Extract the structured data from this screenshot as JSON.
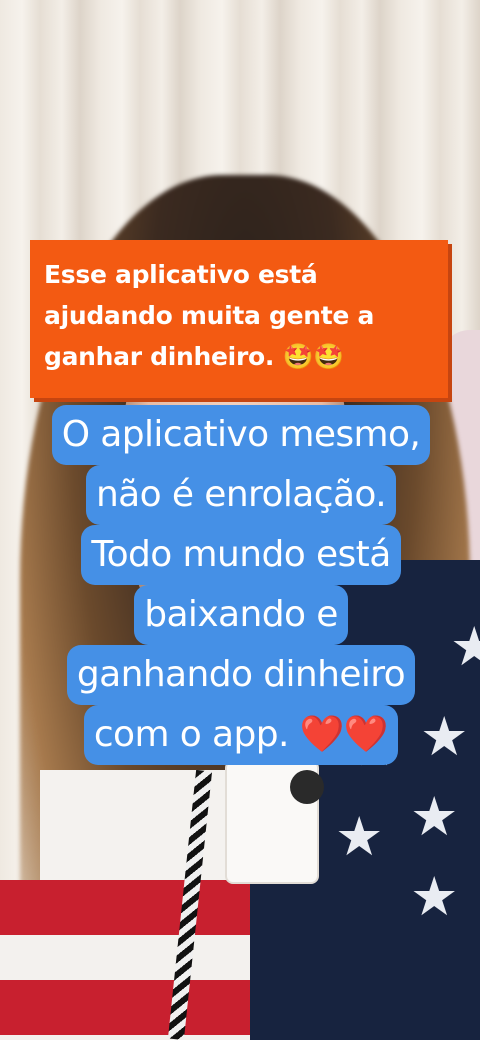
{
  "overlay_top": {
    "text": "Esse aplicativo está ajudando muita gente a ganhar dinheiro. 🤩🤩",
    "lines": [
      "Esse aplicativo está",
      "ajudando muita gente a",
      "ganhar dinheiro. 🤩🤩"
    ],
    "background_color": "#f35a12"
  },
  "overlay_main": {
    "lines": [
      "O aplicativo mesmo,",
      "não é enrolação.",
      "Todo mundo está",
      "baixando e",
      "ganhando dinheiro",
      "com o app. ❤️❤️"
    ],
    "background_color": "#4590e6"
  }
}
